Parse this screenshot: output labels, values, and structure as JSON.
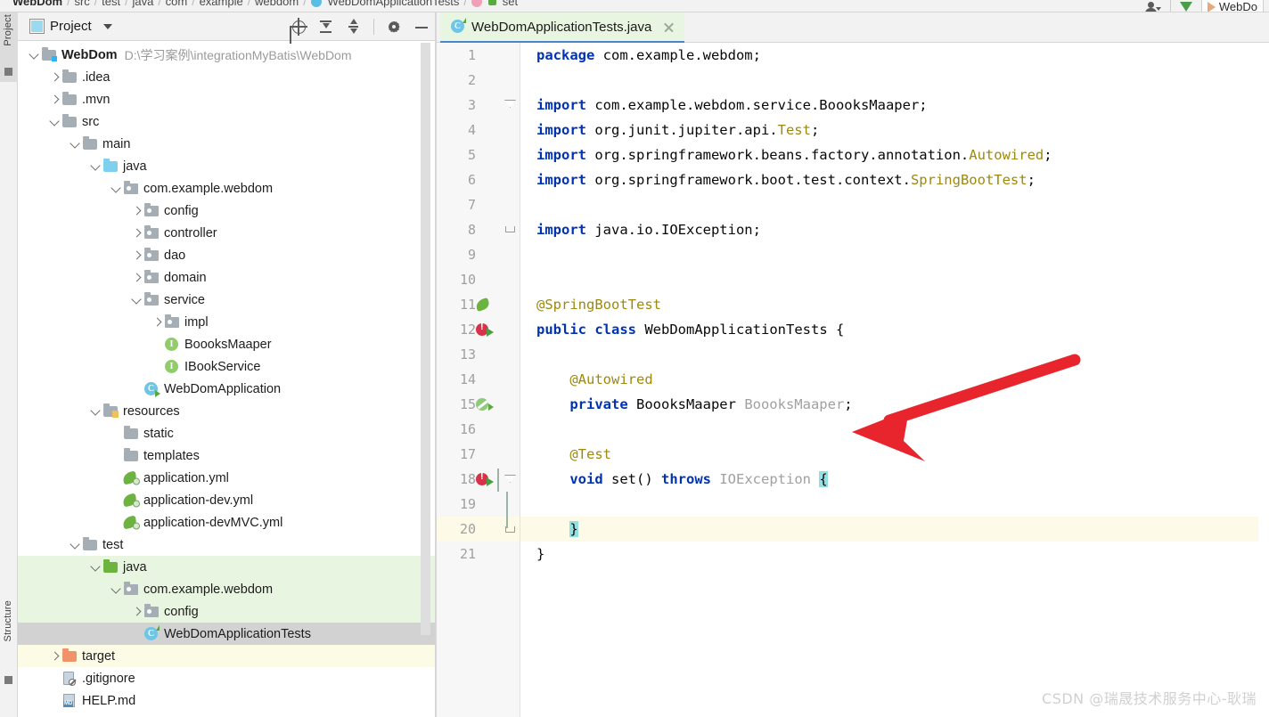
{
  "window": {
    "breadcrumb": {
      "root": "WebDom",
      "items": [
        "src",
        "test",
        "java",
        "com",
        "example",
        "webdom",
        "WebDomApplicationTests",
        "set"
      ],
      "separator": "/"
    },
    "top_right": {
      "person_icon": "person-icon",
      "download_icon": "download-arrow-icon",
      "run_tab_label": "WebDo"
    }
  },
  "left_strip": {
    "project_label": "Project",
    "structure_label": "Structure"
  },
  "project_panel": {
    "title": "Project",
    "title_icon": "project-view-icon",
    "dropdown_icon": "chevron-down-icon",
    "toolbar": [
      {
        "name": "locate-icon",
        "tip": "Select Opened File"
      },
      {
        "name": "expand-all-icon",
        "tip": "Expand All"
      },
      {
        "name": "collapse-all-icon",
        "tip": "Collapse All"
      },
      {
        "name": "settings-gear-icon",
        "tip": "Options"
      },
      {
        "name": "hide-icon",
        "tip": "Hide"
      }
    ],
    "tree": [
      {
        "label": "WebDom",
        "path": "D:\\学习案例\\integrationMyBatis\\WebDom",
        "depth": 0,
        "arrow": "down",
        "icon": "module-folder",
        "bold": true,
        "state": "none"
      },
      {
        "label": ".idea",
        "depth": 1,
        "arrow": "right",
        "icon": "folder-gray",
        "state": "none"
      },
      {
        "label": ".mvn",
        "depth": 1,
        "arrow": "right",
        "icon": "folder-gray",
        "state": "none"
      },
      {
        "label": "src",
        "depth": 1,
        "arrow": "down",
        "icon": "folder-gray",
        "state": "none"
      },
      {
        "label": "main",
        "depth": 2,
        "arrow": "down",
        "icon": "folder-gray",
        "state": "none"
      },
      {
        "label": "java",
        "depth": 3,
        "arrow": "down",
        "icon": "folder-blue",
        "state": "none"
      },
      {
        "label": "com.example.webdom",
        "depth": 4,
        "arrow": "down",
        "icon": "package",
        "state": "none"
      },
      {
        "label": "config",
        "depth": 5,
        "arrow": "right",
        "icon": "package",
        "state": "none"
      },
      {
        "label": "controller",
        "depth": 5,
        "arrow": "right",
        "icon": "package",
        "state": "none"
      },
      {
        "label": "dao",
        "depth": 5,
        "arrow": "right",
        "icon": "package",
        "state": "none"
      },
      {
        "label": "domain",
        "depth": 5,
        "arrow": "right",
        "icon": "package",
        "state": "none"
      },
      {
        "label": "service",
        "depth": 5,
        "arrow": "down",
        "icon": "package",
        "state": "none"
      },
      {
        "label": "impl",
        "depth": 6,
        "arrow": "right",
        "icon": "package",
        "state": "none"
      },
      {
        "label": "BoooksMaaper",
        "depth": 6,
        "arrow": "none",
        "icon": "interface",
        "state": "none"
      },
      {
        "label": "IBookService",
        "depth": 6,
        "arrow": "none",
        "icon": "interface",
        "state": "none"
      },
      {
        "label": "WebDomApplication",
        "depth": 5,
        "arrow": "none",
        "icon": "spring-app",
        "state": "none"
      },
      {
        "label": "resources",
        "depth": 3,
        "arrow": "down",
        "icon": "folder-resources",
        "state": "none"
      },
      {
        "label": "static",
        "depth": 4,
        "arrow": "none",
        "icon": "folder-gray",
        "state": "none"
      },
      {
        "label": "templates",
        "depth": 4,
        "arrow": "none",
        "icon": "folder-gray",
        "state": "none"
      },
      {
        "label": "application.yml",
        "depth": 4,
        "arrow": "none",
        "icon": "spring-yml",
        "state": "none"
      },
      {
        "label": "application-dev.yml",
        "depth": 4,
        "arrow": "none",
        "icon": "spring-yml",
        "state": "none"
      },
      {
        "label": "application-devMVC.yml",
        "depth": 4,
        "arrow": "none",
        "icon": "spring-yml",
        "state": "none"
      },
      {
        "label": "test",
        "depth": 2,
        "arrow": "down",
        "icon": "folder-gray",
        "state": "none"
      },
      {
        "label": "java",
        "depth": 3,
        "arrow": "down",
        "icon": "folder-green",
        "state": "green"
      },
      {
        "label": "com.example.webdom",
        "depth": 4,
        "arrow": "down",
        "icon": "package",
        "state": "green"
      },
      {
        "label": "config",
        "depth": 5,
        "arrow": "right",
        "icon": "package",
        "state": "green"
      },
      {
        "label": "WebDomApplicationTests",
        "depth": 5,
        "arrow": "none",
        "icon": "class-test",
        "state": "selected"
      },
      {
        "label": "target",
        "depth": 1,
        "arrow": "right",
        "icon": "folder-orange",
        "state": "cream"
      },
      {
        "label": ".gitignore",
        "depth": 1,
        "arrow": "none",
        "icon": "gitignore",
        "state": "none"
      },
      {
        "label": "HELP.md",
        "depth": 1,
        "arrow": "none",
        "icon": "markdown",
        "state": "none"
      }
    ]
  },
  "editor": {
    "tab": {
      "label": "WebDomApplicationTests.java",
      "icon": "java-test-class-icon",
      "close_icon": "close-icon"
    },
    "current_line": 20,
    "lines": [
      {
        "n": 1,
        "gutter": "",
        "fold": "",
        "tokens": [
          {
            "t": "package",
            "c": "kw"
          },
          {
            "t": " com.example.webdom;",
            "c": "plain"
          }
        ]
      },
      {
        "n": 2,
        "gutter": "",
        "fold": "",
        "tokens": []
      },
      {
        "n": 3,
        "gutter": "",
        "fold": "open-top",
        "tokens": [
          {
            "t": "import",
            "c": "kw"
          },
          {
            "t": " com.example.webdom.service.BoooksMaaper;",
            "c": "plain"
          }
        ]
      },
      {
        "n": 4,
        "gutter": "",
        "fold": "",
        "tokens": [
          {
            "t": "import",
            "c": "kw"
          },
          {
            "t": " org.junit.jupiter.api.",
            "c": "plain"
          },
          {
            "t": "Test",
            "c": "ann"
          },
          {
            "t": ";",
            "c": "plain"
          }
        ]
      },
      {
        "n": 5,
        "gutter": "",
        "fold": "",
        "tokens": [
          {
            "t": "import",
            "c": "kw"
          },
          {
            "t": " org.springframework.beans.factory.annotation.",
            "c": "plain"
          },
          {
            "t": "Autowired",
            "c": "ann"
          },
          {
            "t": ";",
            "c": "plain"
          }
        ]
      },
      {
        "n": 6,
        "gutter": "",
        "fold": "",
        "tokens": [
          {
            "t": "import",
            "c": "kw"
          },
          {
            "t": " org.springframework.boot.test.context.",
            "c": "plain"
          },
          {
            "t": "SpringBootTest",
            "c": "ann"
          },
          {
            "t": ";",
            "c": "plain"
          }
        ]
      },
      {
        "n": 7,
        "gutter": "",
        "fold": "",
        "tokens": []
      },
      {
        "n": 8,
        "gutter": "",
        "fold": "open-bot",
        "tokens": [
          {
            "t": "import",
            "c": "kw"
          },
          {
            "t": " java.io.IOException;",
            "c": "plain"
          }
        ]
      },
      {
        "n": 9,
        "gutter": "",
        "fold": "",
        "tokens": []
      },
      {
        "n": 10,
        "gutter": "",
        "fold": "",
        "tokens": []
      },
      {
        "n": 11,
        "gutter": "spring-leaf",
        "fold": "",
        "tokens": [
          {
            "t": "@SpringBootTest",
            "c": "ann"
          }
        ]
      },
      {
        "n": 12,
        "gutter": "run-test",
        "fold": "",
        "tokens": [
          {
            "t": "public",
            "c": "kw"
          },
          {
            "t": " ",
            "c": "plain"
          },
          {
            "t": "class",
            "c": "kw"
          },
          {
            "t": " WebDomApplicationTests {",
            "c": "plain"
          }
        ]
      },
      {
        "n": 13,
        "gutter": "",
        "fold": "",
        "tokens": []
      },
      {
        "n": 14,
        "gutter": "",
        "fold": "",
        "tokens": [
          {
            "t": "    @Autowired",
            "c": "ann"
          }
        ]
      },
      {
        "n": 15,
        "gutter": "spring-bean",
        "fold": "",
        "tokens": [
          {
            "t": "    ",
            "c": "plain"
          },
          {
            "t": "private",
            "c": "kw"
          },
          {
            "t": " BoooksMaaper ",
            "c": "plain"
          },
          {
            "t": "BoooksMaaper",
            "c": "gray"
          },
          {
            "t": ";",
            "c": "plain"
          }
        ]
      },
      {
        "n": 16,
        "gutter": "",
        "fold": "",
        "tokens": []
      },
      {
        "n": 17,
        "gutter": "",
        "fold": "",
        "tokens": [
          {
            "t": "    @Test",
            "c": "ann"
          }
        ]
      },
      {
        "n": 18,
        "gutter": "run-test",
        "fold": "tri",
        "tokens": [
          {
            "t": "    ",
            "c": "plain"
          },
          {
            "t": "void",
            "c": "kw"
          },
          {
            "t": " ",
            "c": "plain"
          },
          {
            "t": "set",
            "c": "plain"
          },
          {
            "t": "() ",
            "c": "plain"
          },
          {
            "t": "throws",
            "c": "kw"
          },
          {
            "t": " IOException ",
            "c": "gray"
          },
          {
            "t": "{",
            "c": "brace"
          }
        ]
      },
      {
        "n": 19,
        "gutter": "",
        "fold": "",
        "tokens": []
      },
      {
        "n": 20,
        "gutter": "",
        "fold": "end",
        "tokens": [
          {
            "t": "    ",
            "c": "plain"
          },
          {
            "t": "}",
            "c": "brace"
          }
        ]
      },
      {
        "n": 21,
        "gutter": "",
        "fold": "",
        "tokens": [
          {
            "t": "}",
            "c": "plain"
          }
        ]
      }
    ]
  },
  "annotation": {
    "type": "red-arrow",
    "points_to": "BoooksMaaper field name on line 15",
    "color": "#e8252c"
  },
  "watermark": {
    "text": "CSDN @瑞晟技术服务中心-耿瑞"
  },
  "colors": {
    "keyword": "#0033B3",
    "annotation": "#9E880D",
    "gray_text": "#A0A0A0",
    "brace_highlight": "#93E0E3",
    "current_line": "#FDFBE8",
    "selection": "#D2D2D2",
    "test_scope_green": "#E8F5E0",
    "tab_underline": "#4A86C8",
    "arrow_red": "#E8252C"
  }
}
